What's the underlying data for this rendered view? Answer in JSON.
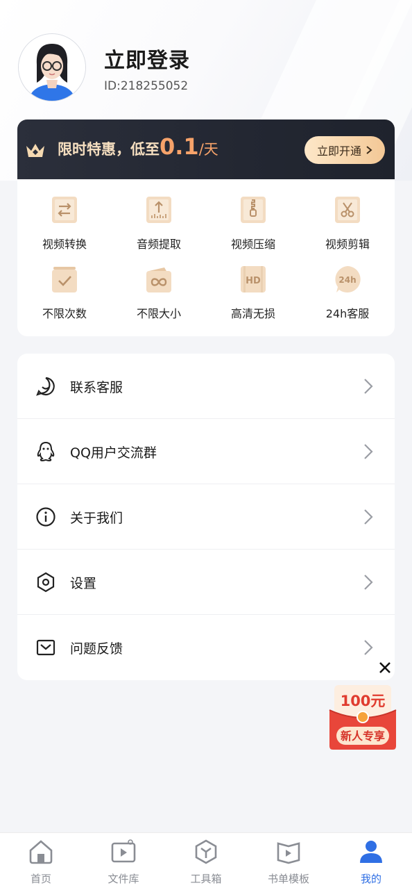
{
  "profile": {
    "login_title": "立即登录",
    "user_id": "ID:218255052"
  },
  "vip": {
    "promo_prefix": "限时特惠，低至",
    "promo_price": "0.1",
    "promo_unit": "/天",
    "open_button": "立即开通",
    "features": [
      {
        "label": "视频转换",
        "icon": "video-convert-icon"
      },
      {
        "label": "音频提取",
        "icon": "audio-extract-icon"
      },
      {
        "label": "视频压缩",
        "icon": "video-compress-icon"
      },
      {
        "label": "视频剪辑",
        "icon": "video-cut-icon"
      },
      {
        "label": "不限次数",
        "icon": "unlimited-times-icon"
      },
      {
        "label": "不限大小",
        "icon": "unlimited-size-icon"
      },
      {
        "label": "高清无损",
        "icon": "hd-lossless-icon"
      },
      {
        "label": "24h客服",
        "icon": "24h-service-icon"
      }
    ],
    "hd_badge": "HD",
    "service_badge": "24h"
  },
  "menu": {
    "items": [
      {
        "label": "联系客服",
        "icon": "chat-icon"
      },
      {
        "label": "QQ用户交流群",
        "icon": "qq-icon"
      },
      {
        "label": "关于我们",
        "icon": "info-icon"
      },
      {
        "label": "设置",
        "icon": "settings-icon"
      },
      {
        "label": "问题反馈",
        "icon": "mail-icon"
      }
    ]
  },
  "promo_popup": {
    "amount": "100元",
    "tag": "新人专享"
  },
  "tabbar": {
    "items": [
      {
        "label": "首页",
        "icon": "home-icon"
      },
      {
        "label": "文件库",
        "icon": "file-library-icon"
      },
      {
        "label": "工具箱",
        "icon": "toolbox-icon"
      },
      {
        "label": "书单模板",
        "icon": "booklist-template-icon"
      },
      {
        "label": "我的",
        "icon": "profile-icon"
      }
    ],
    "active": "我的"
  },
  "colors": {
    "accent": "#2f6fe4",
    "vip_dark": "#232732",
    "vip_gold": "#f6dfc0",
    "price_orange": "#f7a36a",
    "envelope_red": "#e8463a"
  }
}
